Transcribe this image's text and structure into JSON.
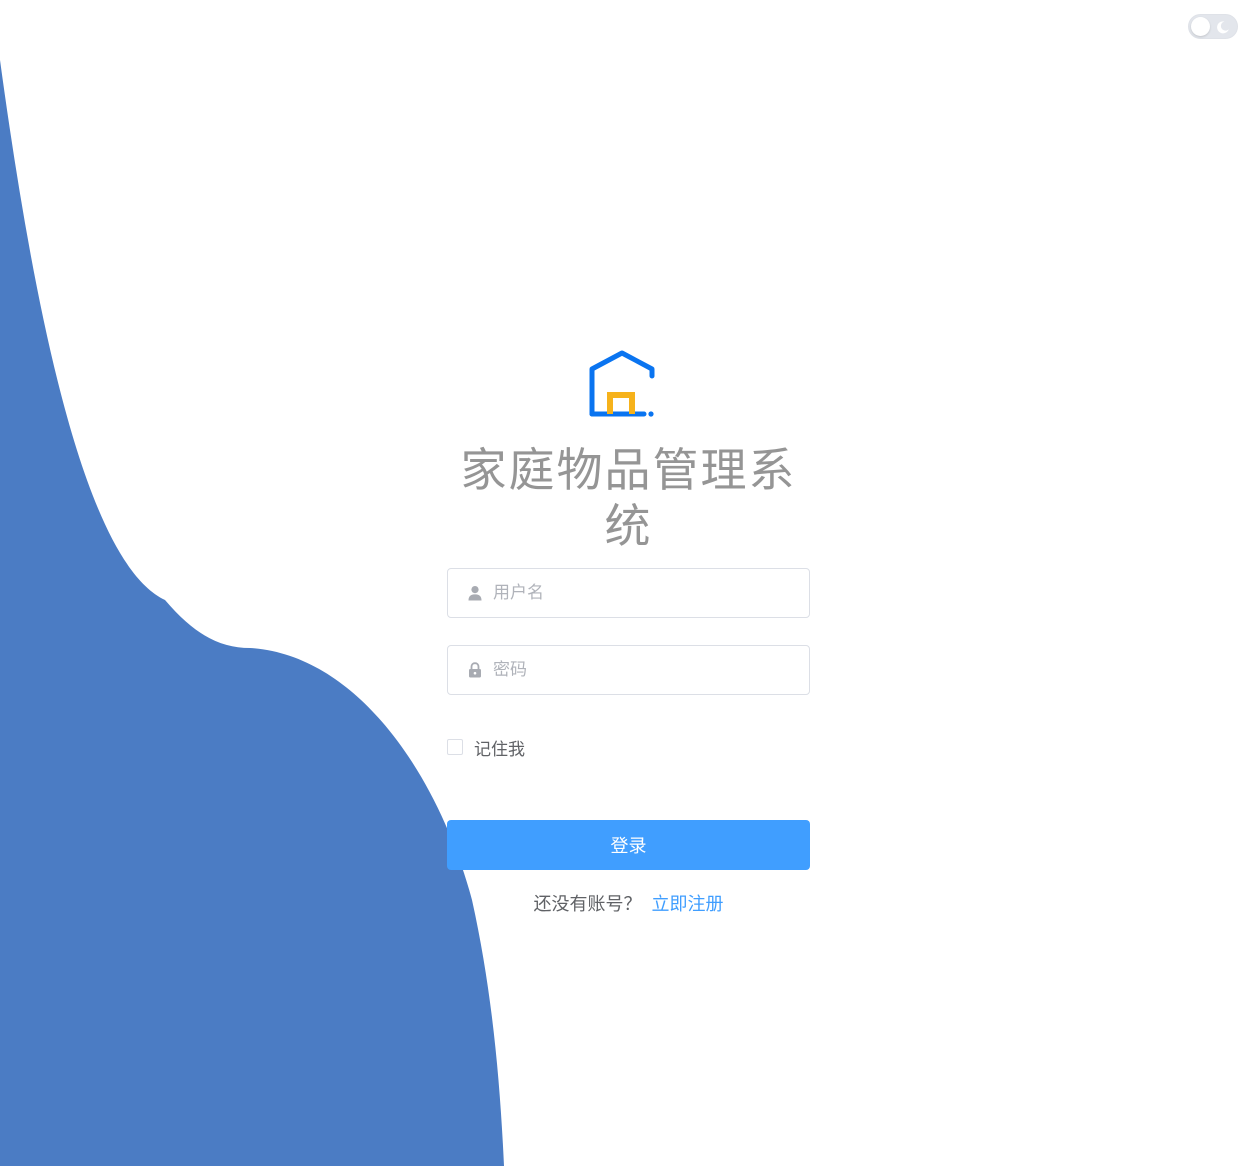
{
  "app": {
    "title": "家庭物品管理系统"
  },
  "theme": {
    "wave_color": "#4b7cc4",
    "accent": "#409eff",
    "logo_blue": "#0a74f0",
    "logo_yellow": "#f6b21b",
    "toggle_icon": "moon-icon"
  },
  "login": {
    "username_placeholder": "用户名",
    "password_placeholder": "密码",
    "username_icon": "user-icon",
    "password_icon": "lock-icon",
    "remember_label": "记住我",
    "remember_checked": false,
    "submit_label": "登录",
    "register_prompt": "还没有账号？",
    "register_link": "立即注册"
  }
}
